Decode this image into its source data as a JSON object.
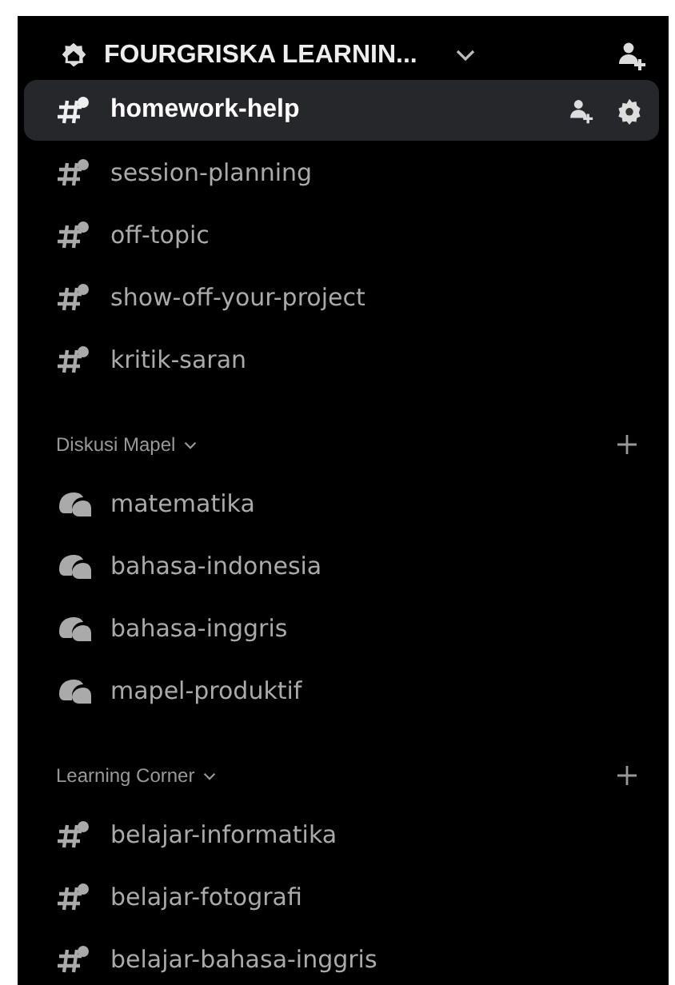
{
  "server": {
    "name": "FOURGRISKA LEARNIN..."
  },
  "sections": [
    {
      "channels": [
        {
          "name": "homework-help",
          "kind": "text",
          "selected": true
        },
        {
          "name": "session-planning",
          "kind": "text",
          "selected": false
        },
        {
          "name": "off-topic",
          "kind": "text",
          "selected": false
        },
        {
          "name": "show-off-your-project",
          "kind": "text",
          "selected": false
        },
        {
          "name": "kritik-saran",
          "kind": "text",
          "selected": false
        }
      ]
    },
    {
      "title": "Diskusi Mapel",
      "channels": [
        {
          "name": "matematika",
          "kind": "forum",
          "selected": false
        },
        {
          "name": "bahasa-indonesia",
          "kind": "forum",
          "selected": false
        },
        {
          "name": "bahasa-inggris",
          "kind": "forum",
          "selected": false
        },
        {
          "name": "mapel-produktif",
          "kind": "forum",
          "selected": false
        }
      ]
    },
    {
      "title": "Learning Corner",
      "channels": [
        {
          "name": "belajar-informatika",
          "kind": "text",
          "selected": false
        },
        {
          "name": "belajar-fotografi",
          "kind": "text",
          "selected": false
        },
        {
          "name": "belajar-bahasa-inggris",
          "kind": "text",
          "selected": false
        }
      ]
    }
  ]
}
